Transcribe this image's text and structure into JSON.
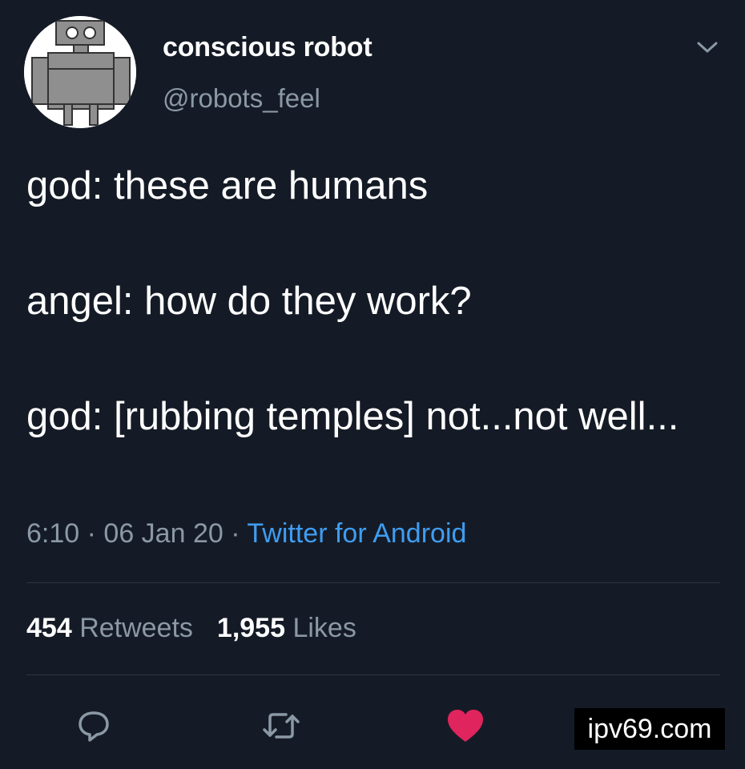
{
  "author": {
    "display_name": "conscious robot",
    "handle": "@robots_feel"
  },
  "tweet": {
    "text": "god: these are humans\n\nangel: how do they work?\n\ngod: [rubbing temples] not...not well...",
    "time": "6:10",
    "date": "06 Jan 20",
    "separator": "·",
    "source": "Twitter for Android"
  },
  "stats": {
    "retweets_count": "454",
    "retweets_label": "Retweets",
    "likes_count": "1,955",
    "likes_label": "Likes"
  },
  "actions": {
    "reply_icon": "reply-icon",
    "retweet_icon": "retweet-icon",
    "like_icon": "heart-icon",
    "like_active": true,
    "share_icon": "share-icon"
  },
  "watermark": {
    "text": "ipv69.com"
  },
  "colors": {
    "background": "#151b26",
    "link": "#3f9df2",
    "muted": "#8b98a5",
    "like": "#e0245e"
  }
}
